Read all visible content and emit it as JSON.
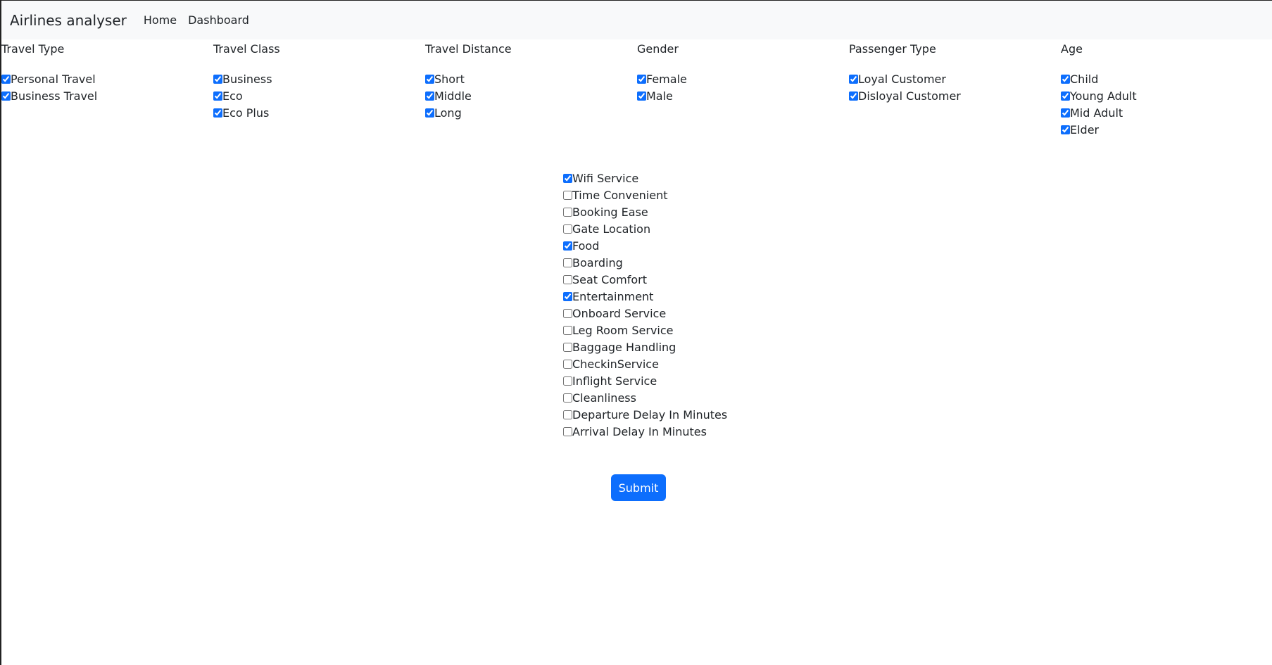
{
  "navbar": {
    "brand": "Airlines analyser",
    "links": [
      "Home",
      "Dashboard"
    ]
  },
  "filters": [
    {
      "title": "Travel Type",
      "options": [
        {
          "label": "Personal Travel",
          "checked": true
        },
        {
          "label": "Business Travel",
          "checked": true
        }
      ]
    },
    {
      "title": "Travel Class",
      "options": [
        {
          "label": "Business",
          "checked": true
        },
        {
          "label": "Eco",
          "checked": true
        },
        {
          "label": "Eco Plus",
          "checked": true
        }
      ]
    },
    {
      "title": "Travel Distance",
      "options": [
        {
          "label": "Short",
          "checked": true
        },
        {
          "label": "Middle",
          "checked": true
        },
        {
          "label": "Long",
          "checked": true
        }
      ]
    },
    {
      "title": "Gender",
      "options": [
        {
          "label": "Female",
          "checked": true
        },
        {
          "label": "Male",
          "checked": true
        }
      ]
    },
    {
      "title": "Passenger Type",
      "options": [
        {
          "label": "Loyal Customer",
          "checked": true
        },
        {
          "label": "Disloyal Customer",
          "checked": true
        }
      ]
    },
    {
      "title": "Age",
      "options": [
        {
          "label": "Child",
          "checked": true
        },
        {
          "label": "Young Adult",
          "checked": true
        },
        {
          "label": "Mid Adult",
          "checked": true
        },
        {
          "label": "Elder",
          "checked": true
        }
      ]
    }
  ],
  "services": [
    {
      "label": "Wifi Service",
      "checked": true
    },
    {
      "label": "Time Convenient",
      "checked": false
    },
    {
      "label": "Booking Ease",
      "checked": false
    },
    {
      "label": "Gate Location",
      "checked": false
    },
    {
      "label": "Food",
      "checked": true
    },
    {
      "label": "Boarding",
      "checked": false
    },
    {
      "label": "Seat Comfort",
      "checked": false
    },
    {
      "label": "Entertainment",
      "checked": true
    },
    {
      "label": "Onboard Service",
      "checked": false
    },
    {
      "label": "Leg Room Service",
      "checked": false
    },
    {
      "label": "Baggage Handling",
      "checked": false
    },
    {
      "label": "CheckinService",
      "checked": false
    },
    {
      "label": "Inflight Service",
      "checked": false
    },
    {
      "label": "Cleanliness",
      "checked": false
    },
    {
      "label": "Departure Delay In Minutes",
      "checked": false
    },
    {
      "label": "Arrival Delay In Minutes",
      "checked": false
    }
  ],
  "submit_label": "Submit",
  "colors": {
    "accent": "#0d6efd",
    "navbar_bg": "#f8f9fa"
  }
}
